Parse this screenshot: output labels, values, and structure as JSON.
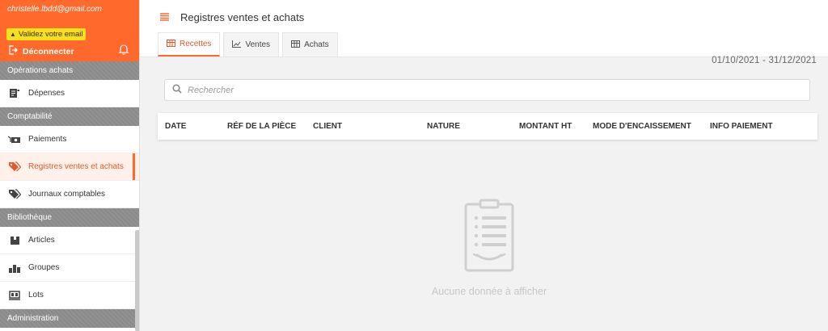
{
  "sidebar": {
    "email": "christelle.lbdd@gmail.com",
    "validate_email": "Validez votre email",
    "logout": "Déconnecter",
    "sections": {
      "achats": "Opérations achats",
      "compta": "Comptabilité",
      "biblio": "Bibliothèque",
      "admin": "Administration"
    },
    "items": {
      "depenses": "Dépenses",
      "paiements": "Paiements",
      "registres": "Registres ventes et achats",
      "journaux": "Journaux comptables",
      "articles": "Articles",
      "groupes": "Groupes",
      "lots": "Lots"
    },
    "accent": "#ff6a2c"
  },
  "header": {
    "title": "Registres ventes et achats",
    "tabs": {
      "recettes": "Recettes",
      "ventes": "Ventes",
      "achats": "Achats"
    }
  },
  "date_range": "01/10/2021 - 31/12/2021",
  "search": {
    "placeholder": "Rechercher"
  },
  "table": {
    "columns": {
      "date": "DATE",
      "ref": "RÉF DE LA PIÈCE",
      "client": "CLIENT",
      "nature": "NATURE",
      "montant": "MONTANT HT",
      "mode": "MODE D'ENCAISSEMENT",
      "info": "INFO PAIEMENT"
    },
    "empty_message": "Aucune donnée à afficher"
  }
}
